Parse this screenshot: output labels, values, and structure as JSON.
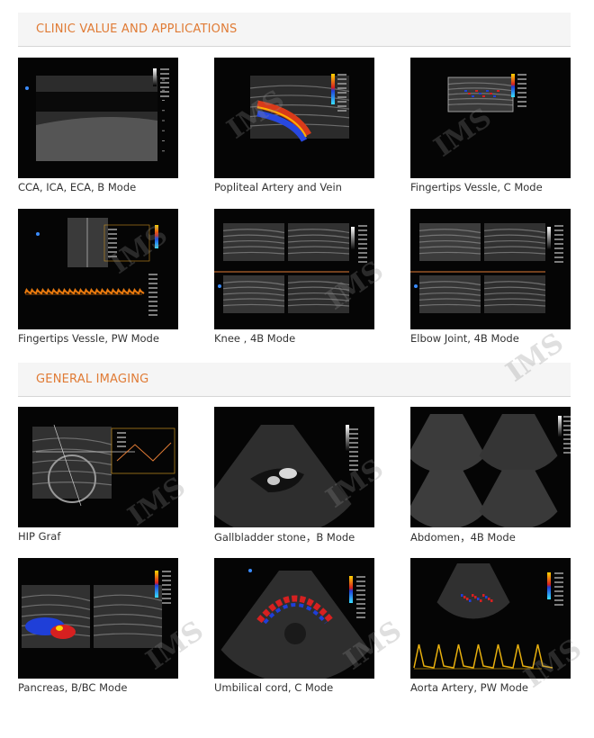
{
  "sections": [
    {
      "title": "CLINIC VALUE AND APPLICATIONS",
      "items": [
        {
          "caption": "CCA, ICA, ECA, B Mode",
          "kind": "vessel-b"
        },
        {
          "caption": "Popliteal Artery and Vein",
          "kind": "color-vessel"
        },
        {
          "caption": "Fingertips Vessle, C Mode",
          "kind": "color-box"
        },
        {
          "caption": "Fingertips Vessle, PW Mode",
          "kind": "pw-small"
        },
        {
          "caption": "Knee , 4B Mode",
          "kind": "quad-b"
        },
        {
          "caption": "Elbow Joint, 4B Mode",
          "kind": "quad-b2"
        }
      ]
    },
    {
      "title": "GENERAL IMAGING",
      "items": [
        {
          "caption": "HIP Graf",
          "kind": "hip"
        },
        {
          "caption": "Gallbladder stone，B Mode",
          "kind": "sector"
        },
        {
          "caption": "Abdomen，4B Mode",
          "kind": "quad-abd"
        },
        {
          "caption": "Pancreas, B/BC Mode",
          "kind": "dual-color"
        },
        {
          "caption": "Umbilical cord, C Mode",
          "kind": "sector-color"
        },
        {
          "caption": "Aorta Artery, PW Mode",
          "kind": "pw-aorta"
        }
      ]
    }
  ],
  "watermark_text": "IMS",
  "colors": {
    "heading": "#e07b35",
    "header_bg": "#f5f5f5",
    "caption": "#333333"
  }
}
